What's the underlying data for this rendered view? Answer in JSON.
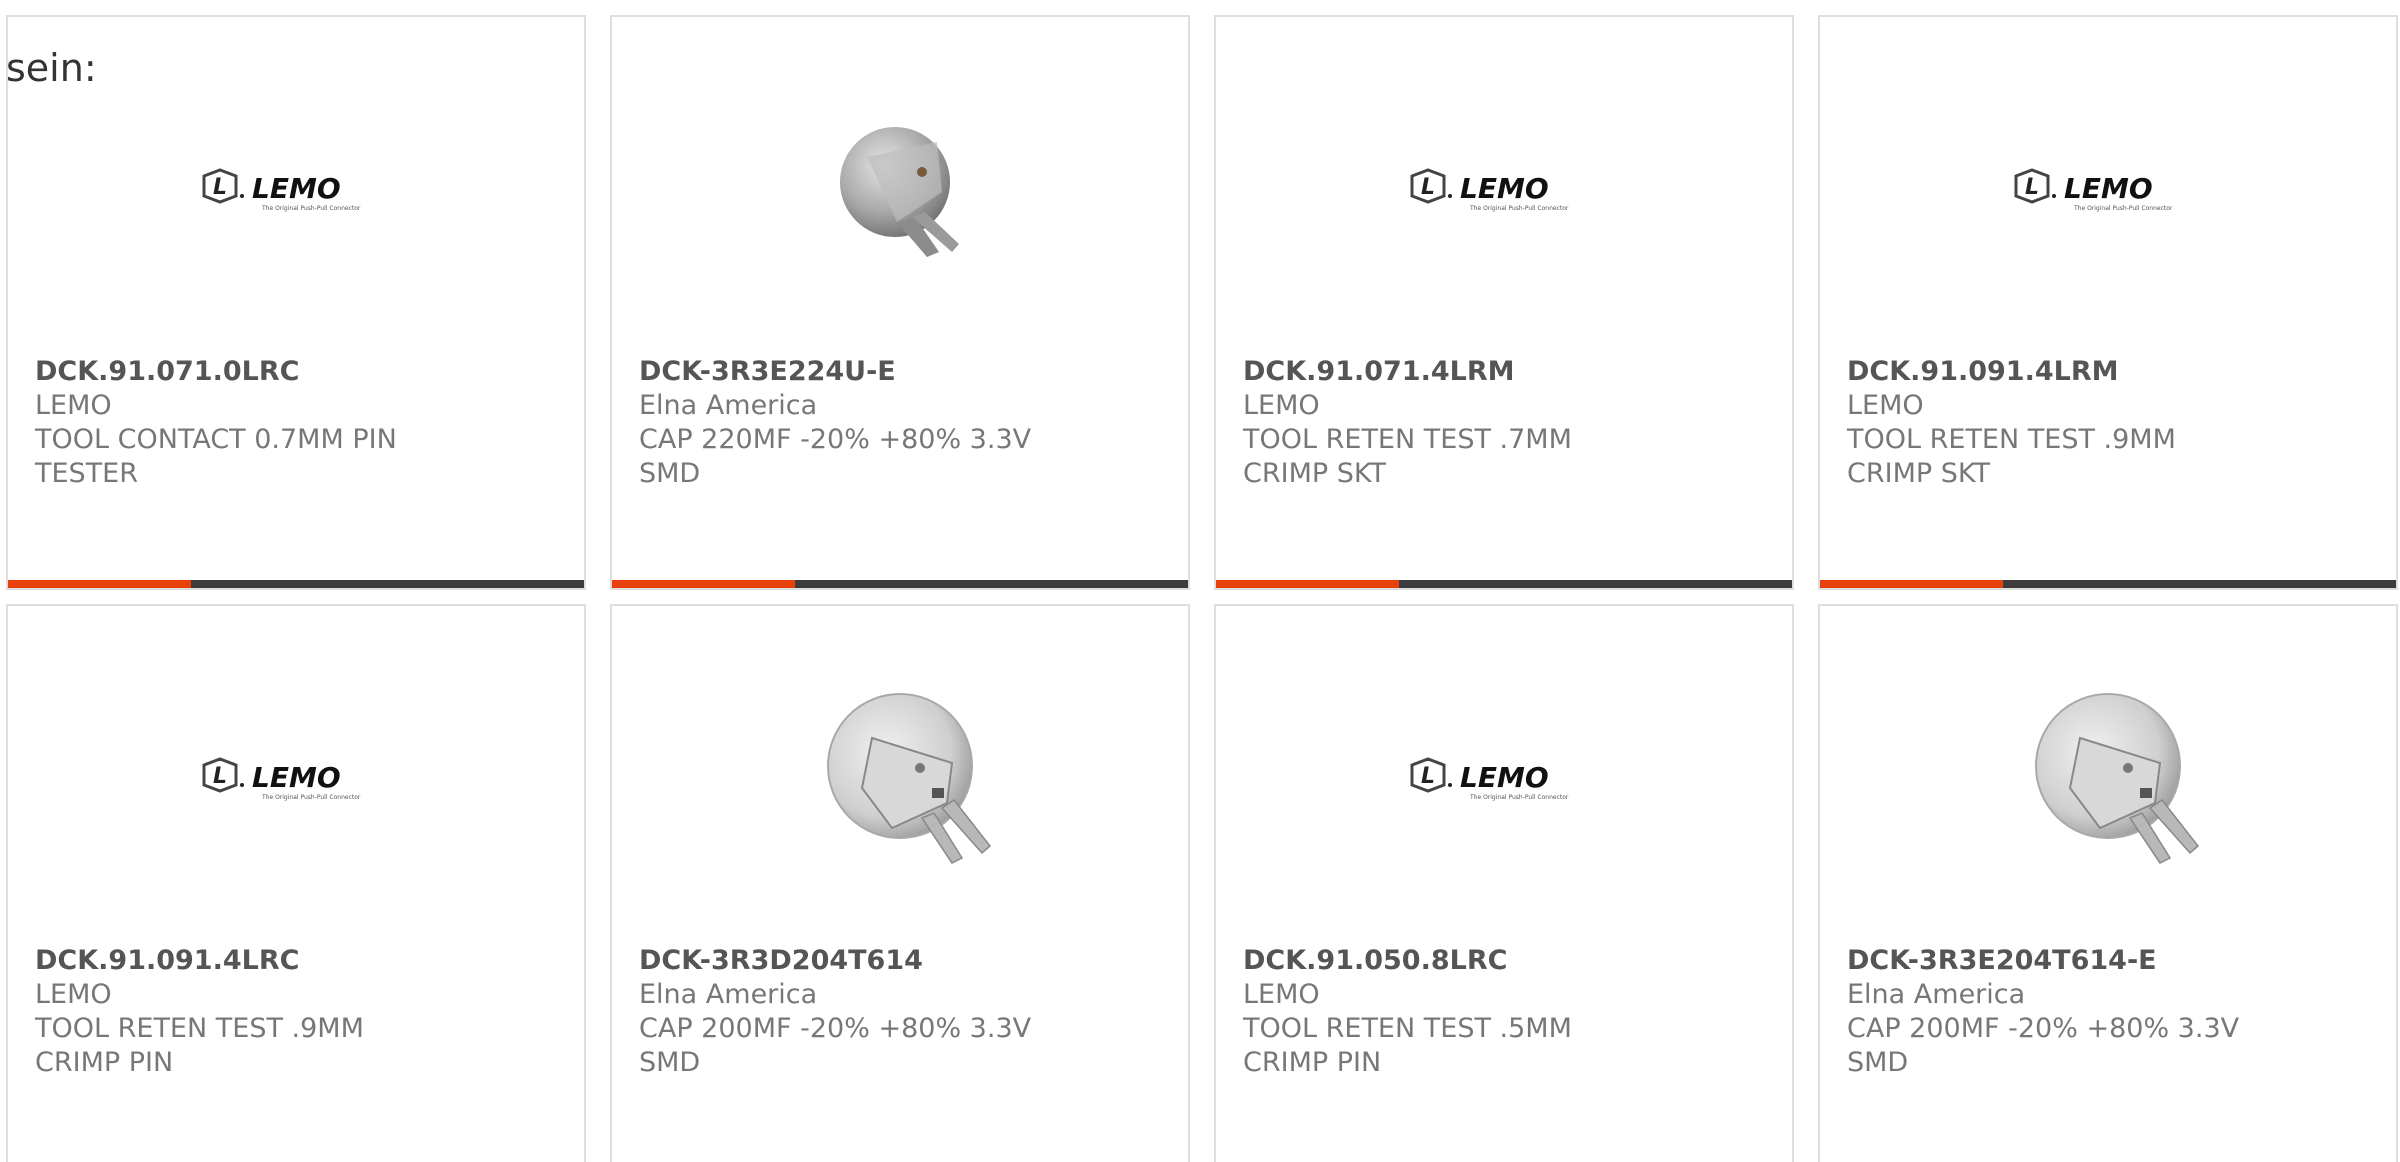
{
  "intro": {
    "text": "sein:"
  },
  "colors": {
    "accent": "#e8400b",
    "bar": "#3c3c3c",
    "border": "#dedede",
    "text": "#777777",
    "title": "#555555"
  },
  "logo": {
    "brand": "LEMO",
    "tagline": "The Original Push-Pull Connector"
  },
  "products": [
    {
      "part": "DCK.91.071.0LRC",
      "mfr": "LEMO",
      "desc": "TOOL CONTACT 0.7MM PIN TESTER",
      "image": "lemo-logo"
    },
    {
      "part": "DCK-3R3E224U-E",
      "mfr": "Elna America",
      "desc": "CAP 220MF -20% +80% 3.3V SMD",
      "image": "coin-capacitor"
    },
    {
      "part": "DCK.91.071.4LRM",
      "mfr": "LEMO",
      "desc": "TOOL RETEN TEST .7MM CRIMP SKT",
      "image": "lemo-logo"
    },
    {
      "part": "DCK.91.091.4LRM",
      "mfr": "LEMO",
      "desc": "TOOL RETEN TEST .9MM CRIMP SKT",
      "image": "lemo-logo"
    },
    {
      "part": "DCK.91.091.4LRC",
      "mfr": "LEMO",
      "desc": "TOOL RETEN TEST .9MM CRIMP PIN",
      "image": "lemo-logo"
    },
    {
      "part": "DCK-3R3D204T614",
      "mfr": "Elna America",
      "desc": "CAP 200MF -20% +80% 3.3V SMD",
      "image": "coin-capacitor"
    },
    {
      "part": "DCK.91.050.8LRC",
      "mfr": "LEMO",
      "desc": "TOOL RETEN TEST .5MM CRIMP PIN",
      "image": "lemo-logo"
    },
    {
      "part": "DCK-3R3E204T614-E",
      "mfr": "Elna America",
      "desc": "CAP 200MF -20% +80% 3.3V SMD",
      "image": "coin-capacitor"
    }
  ]
}
